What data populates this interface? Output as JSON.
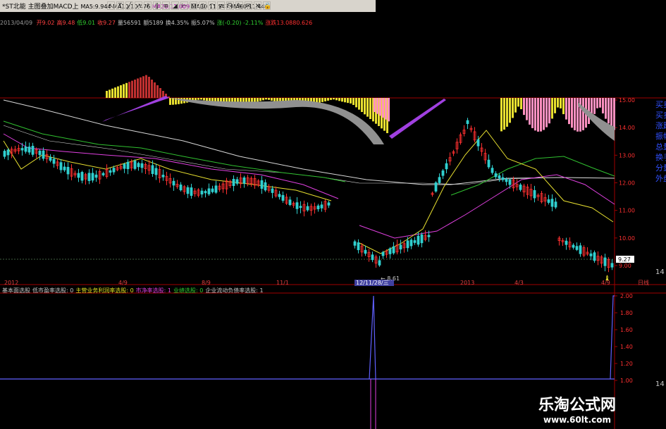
{
  "toolbar": {
    "stock_name": "*ST北能",
    "indicator": "主图叠加MACD上",
    "ma_items": [
      "MA5:9.944",
      "MA10:10.476",
      "MA20:11.009",
      "MA30:11.547",
      "MA60:11.446"
    ],
    "icons": [
      "cursor-icon",
      "text-icon",
      "line-icon",
      "ray-icon",
      "channel-icon",
      "parallel-icon",
      "fib-icon",
      "gann-icon",
      "ruler-icon",
      "rect-icon",
      "ellipse-icon",
      "arc-icon",
      "arrow-icon",
      "copy-icon",
      "paint-icon",
      "note-icon",
      "delete-icon",
      "lock-icon"
    ]
  },
  "info": {
    "date": "2013/04/09",
    "items": [
      {
        "label": "开",
        "value": "9.02",
        "color": "#ff4040"
      },
      {
        "label": "高",
        "value": "9.48",
        "color": "#ff4040"
      },
      {
        "label": "低",
        "value": "9.01",
        "color": "#30d030"
      },
      {
        "label": "收",
        "value": "9.27",
        "color": "#ff4040"
      },
      {
        "label": "量",
        "value": "56591",
        "color": "#c8c8c8"
      },
      {
        "label": "额",
        "value": "5189",
        "color": "#c8c8c8"
      },
      {
        "label": "换",
        "value": "4.35%",
        "color": "#c8c8c8"
      },
      {
        "label": "振",
        "value": "5.07%",
        "color": "#c8c8c8"
      },
      {
        "label": "涨",
        "value": "(-0.20) -2.11%",
        "color": "#30d030"
      },
      {
        "label": "涨跌",
        "value": "13.0880.626",
        "color": "#ff3030"
      }
    ]
  },
  "price_axis": [
    "15.00",
    "14.00",
    "13.00",
    "12.00",
    "11.00",
    "10.00",
    "9.00"
  ],
  "current_price": "9.27",
  "low_label": "8.61",
  "right_labels": [
    "买卖",
    "买卖",
    "涨跌",
    "振幅",
    "总量",
    "换手",
    "分量",
    "外盘"
  ],
  "date_axis": [
    "2012",
    "4/9",
    "8/9",
    "11/1",
    "12/11/28/三",
    "2013",
    "4/3",
    "4/9",
    "日线"
  ],
  "lower_axis": [
    "2.00",
    "1.80",
    "1.60",
    "1.40",
    "1.20",
    "1.00"
  ],
  "right_tail": [
    "14",
    "14"
  ],
  "indicator_bar": [
    {
      "text": "基本面选股",
      "color": "#c8c8c8"
    },
    {
      "text": "低市盈率选股: 0",
      "color": "#c8c8c8"
    },
    {
      "text": "主营业务利润率选股: 0",
      "color": "#e0e020"
    },
    {
      "text": "市净率选股: 1",
      "color": "#e040e0"
    },
    {
      "text": "业绩选股: 0",
      "color": "#30d030"
    },
    {
      "text": "企业流动负债率选股: 1",
      "color": "#c8c8c8"
    },
    {
      "text": "",
      "color": "#6060ff"
    }
  ],
  "watermark": {
    "title": "乐淘公式网",
    "url": "www.60lt.com"
  },
  "colors": {
    "up": "#ff3030",
    "down": "#30d0d0",
    "axis": "#a00000",
    "ma_white": "#d8d8d8",
    "ma_yellow": "#e8e030",
    "ma_magenta": "#e040e0",
    "ma_green": "#30c030",
    "macd_purple": "#a040e0"
  }
}
